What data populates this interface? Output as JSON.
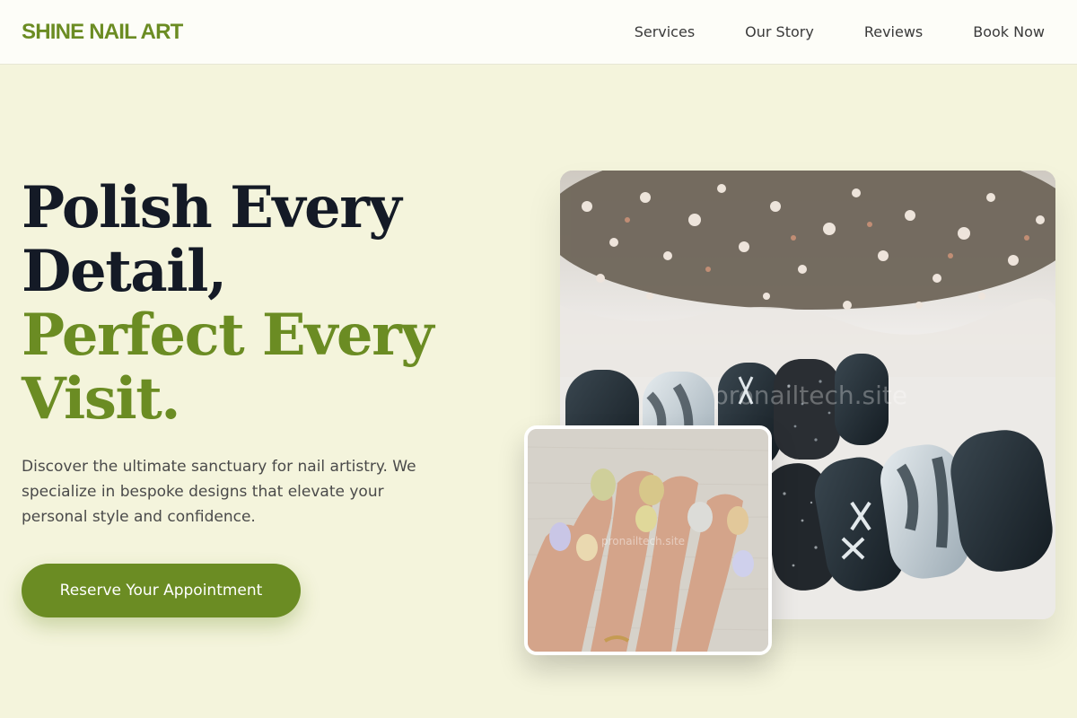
{
  "brand": {
    "logo": "SHINE NAIL ART"
  },
  "nav": {
    "items": [
      {
        "label": "Services"
      },
      {
        "label": "Our Story"
      },
      {
        "label": "Reviews"
      },
      {
        "label": "Book Now"
      }
    ]
  },
  "hero": {
    "title_lines": [
      "Polish Every",
      "Detail,"
    ],
    "title_accent_lines": [
      "Perfect Every",
      "Visit."
    ],
    "description": "Discover the ultimate sanctuary for nail artistry. We specialize in bespoke designs that elevate your personal style and confidence.",
    "cta_label": "Reserve Your Appointment"
  },
  "images": {
    "main_watermark": "pronailtech.site",
    "inset_watermark": "pronailtech.site"
  },
  "colors": {
    "accent": "#6b8c23",
    "background": "#f4f4dc",
    "header_bg": "#fdfdf8",
    "heading": "#141a26"
  }
}
